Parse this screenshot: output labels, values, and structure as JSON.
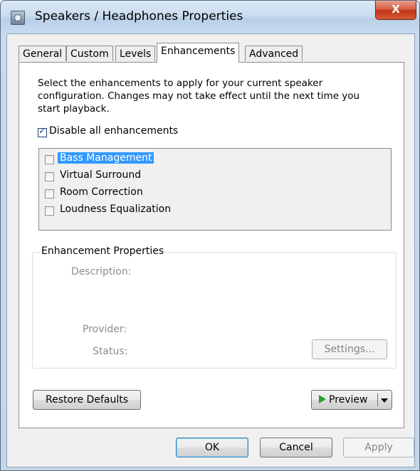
{
  "window": {
    "title": "Speakers / Headphones Properties",
    "close_label": "X"
  },
  "tabs": [
    {
      "label": "General",
      "active": false
    },
    {
      "label": "Custom",
      "active": false
    },
    {
      "label": "Levels",
      "active": false
    },
    {
      "label": "Enhancements",
      "active": true
    },
    {
      "label": "Advanced",
      "active": false
    }
  ],
  "enhancements": {
    "instructions": "Select the enhancements to apply for your current speaker configuration. Changes may not take effect until the next time you start playback.",
    "disable_all": {
      "label": "Disable all enhancements",
      "checked": true
    },
    "list": [
      {
        "label": "Bass Management",
        "checked": false,
        "selected": true
      },
      {
        "label": "Virtual Surround",
        "checked": false,
        "selected": false
      },
      {
        "label": "Room Correction",
        "checked": false,
        "selected": false
      },
      {
        "label": "Loudness Equalization",
        "checked": false,
        "selected": false
      }
    ],
    "properties": {
      "title": "Enhancement Properties",
      "description_label": "Description:",
      "provider_label": "Provider:",
      "status_label": "Status:",
      "settings_button": "Settings..."
    },
    "restore_defaults": "Restore Defaults",
    "preview": "Preview"
  },
  "footer": {
    "ok": "OK",
    "cancel": "Cancel",
    "apply": "Apply"
  },
  "colors": {
    "selection": "#3399ff",
    "close_button": "#c0341a",
    "play_icon": "#2aa02a"
  }
}
